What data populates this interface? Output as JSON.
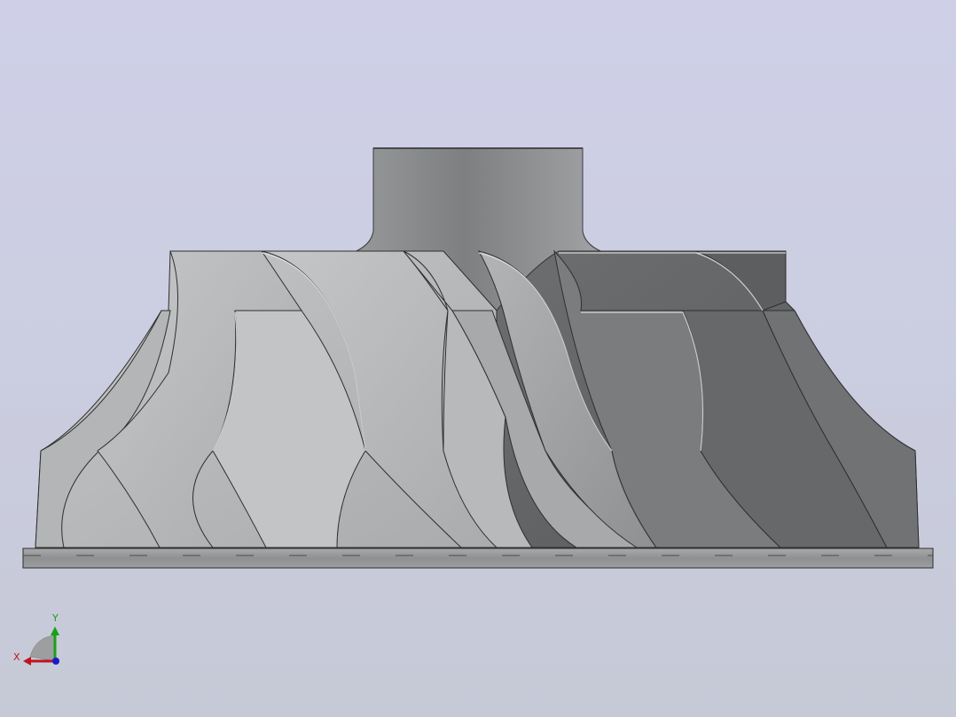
{
  "viewport": {
    "background_top": "#cfd0e8",
    "background_bottom": "#c6c9d6",
    "model": "impeller"
  },
  "triad": {
    "x_label": "X",
    "y_label": "Y",
    "x_color": "#c0141c",
    "y_color": "#18a018",
    "z_color": "#1a1ac8"
  }
}
